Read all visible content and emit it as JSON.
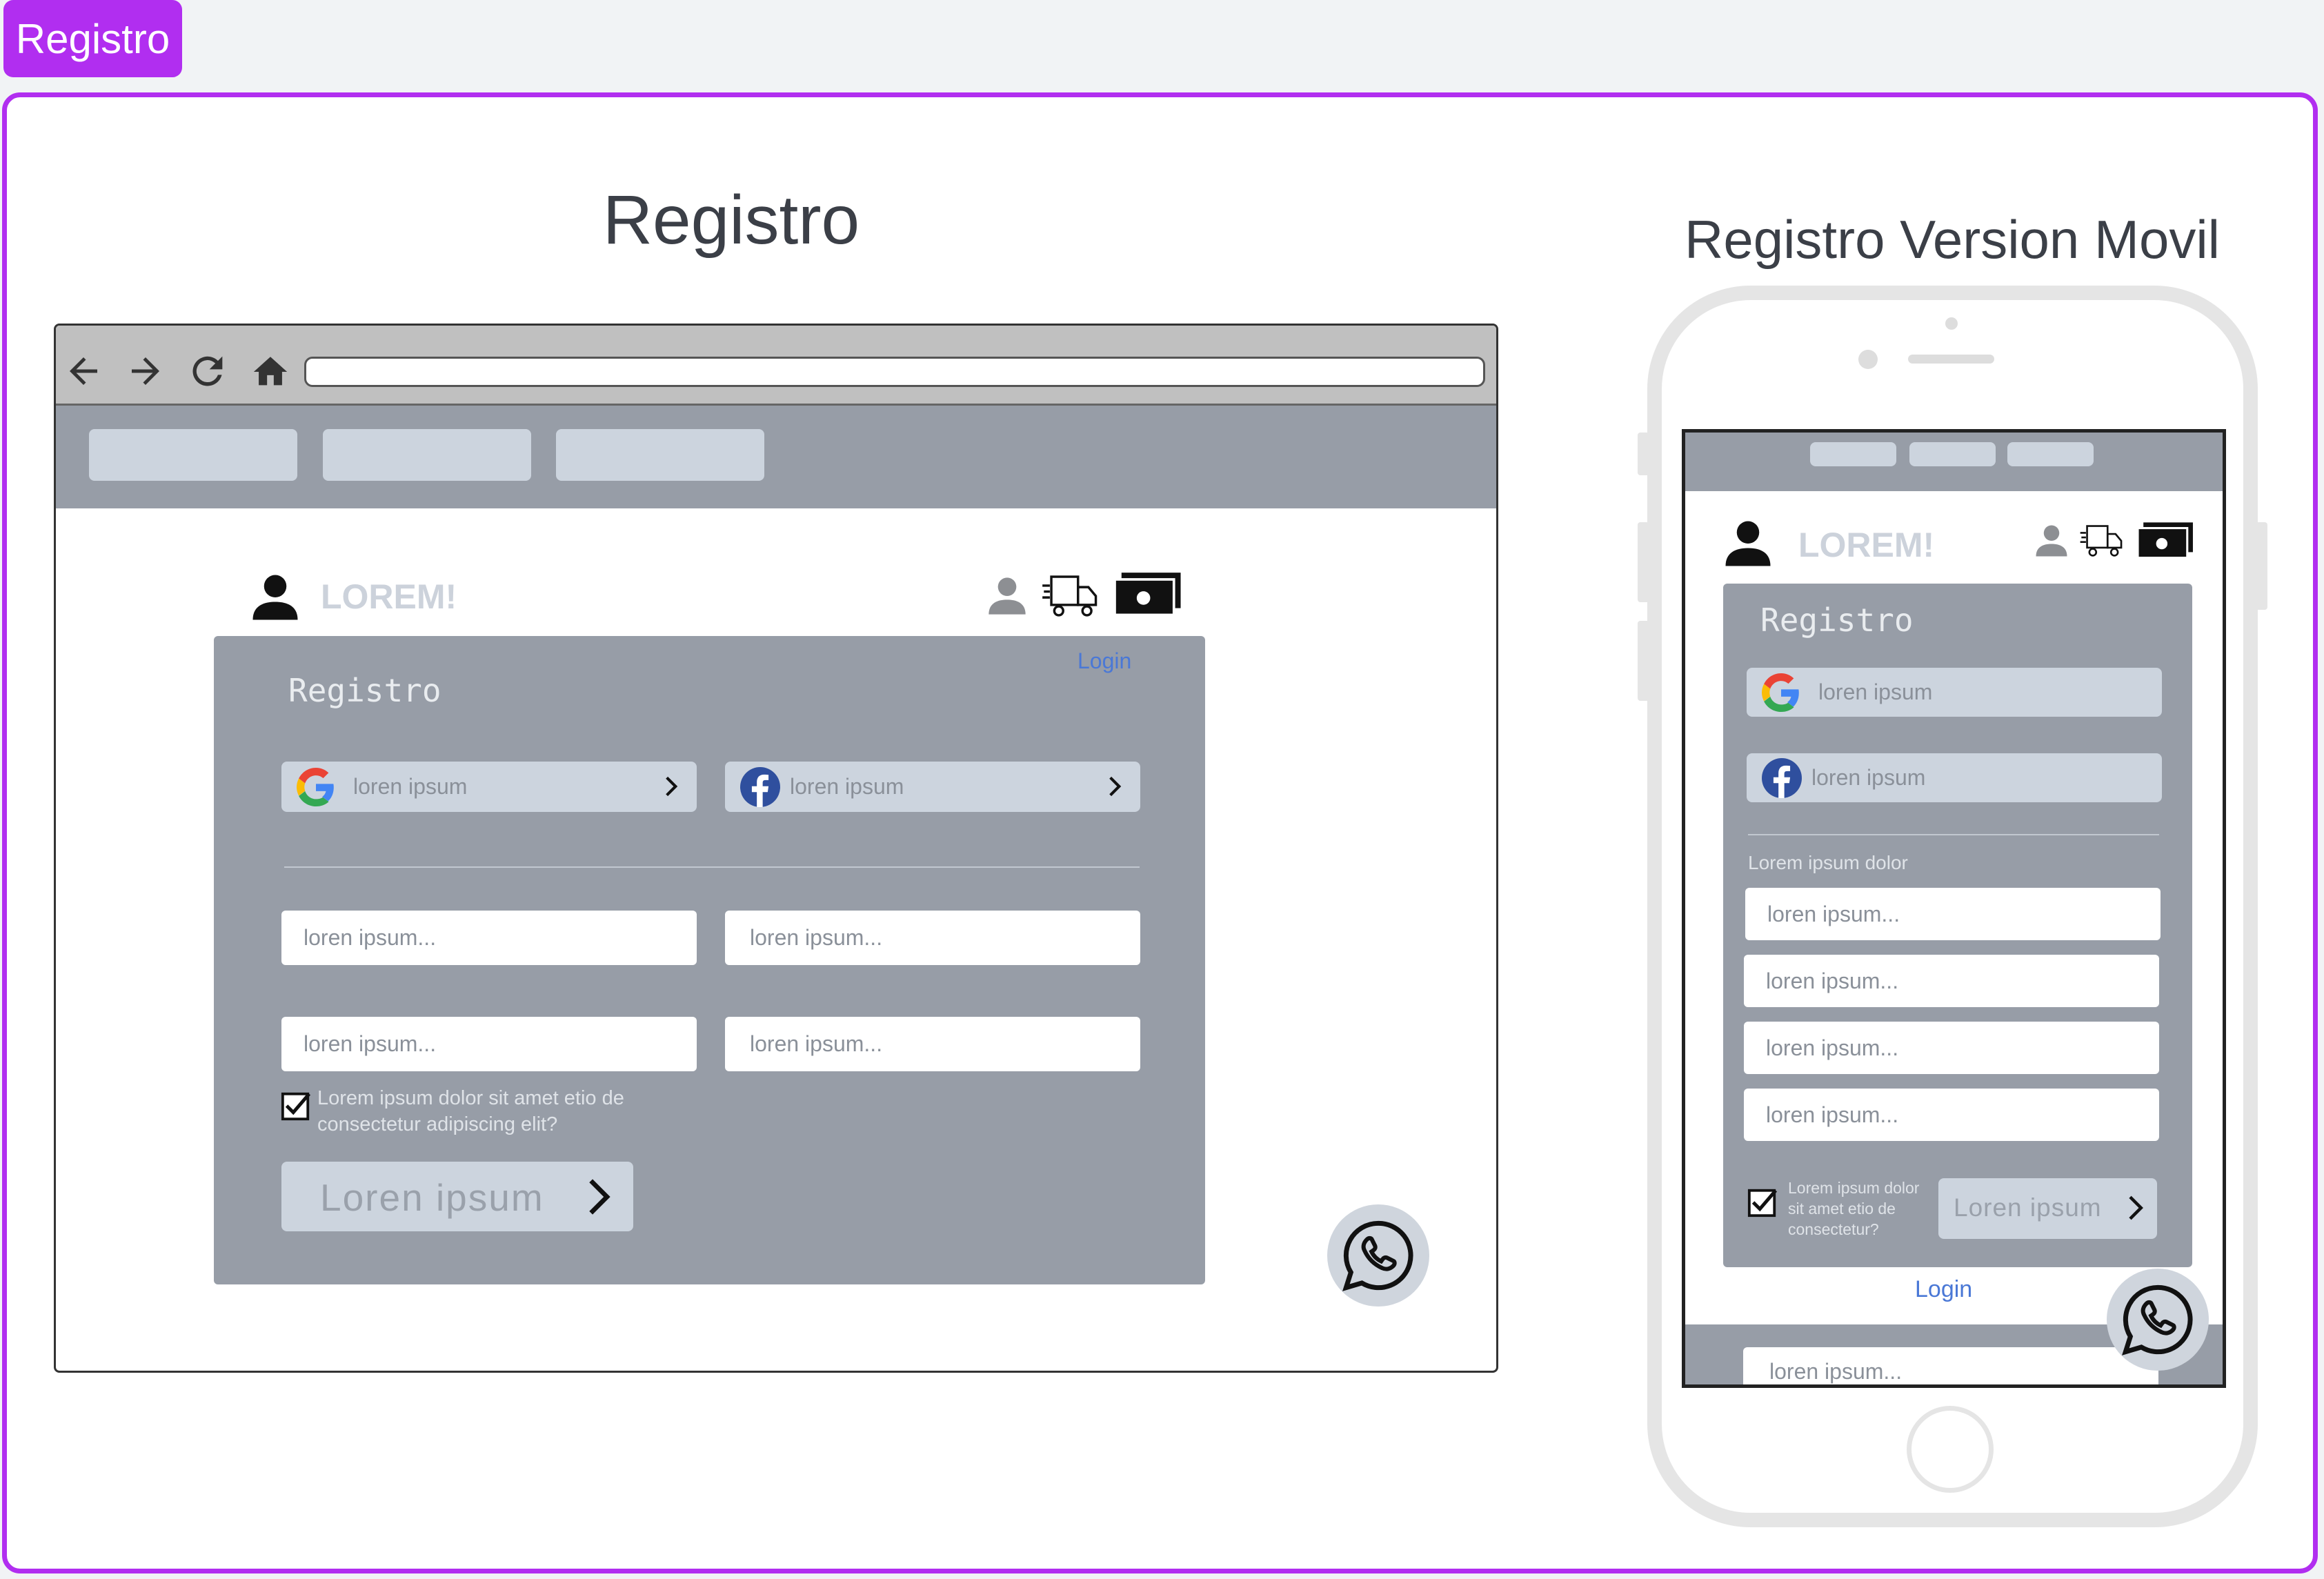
{
  "board": {
    "tag_label": "Registro"
  },
  "desktop": {
    "heading": "Registro",
    "browser": {
      "url_value": "",
      "nav_items": [
        "",
        "",
        ""
      ]
    },
    "header": {
      "brand": "LOREM!"
    },
    "form": {
      "title": "Registro",
      "login_link": "Login",
      "google_label": "loren ipsum",
      "facebook_label": "loren ipsum",
      "field_placeholders": [
        "loren ipsum...",
        "loren ipsum...",
        "loren ipsum...",
        "loren ipsum..."
      ],
      "terms_text": "Lorem ipsum dolor sit amet etio de consectetur adipiscing elit?",
      "submit_label": "Loren ipsum"
    }
  },
  "mobile": {
    "heading": "Registro Version Movil",
    "header": {
      "brand": "LOREM!"
    },
    "form": {
      "title": "Registro",
      "google_label": "loren ipsum",
      "facebook_label": "loren ipsum",
      "section_label": "Lorem ipsum dolor",
      "field_placeholders": [
        "loren ipsum...",
        "loren ipsum...",
        "loren ipsum...",
        "loren ipsum..."
      ],
      "terms_text": "Lorem ipsum dolor sit amet etio de consectetur?",
      "submit_label": "Loren ipsum"
    },
    "login_link": "Login",
    "footer_field": "loren ipsum..."
  },
  "colors": {
    "accent": "#b12ef0",
    "panel": "#979da7",
    "pill": "#ccd4de",
    "link": "#4a78d6"
  }
}
